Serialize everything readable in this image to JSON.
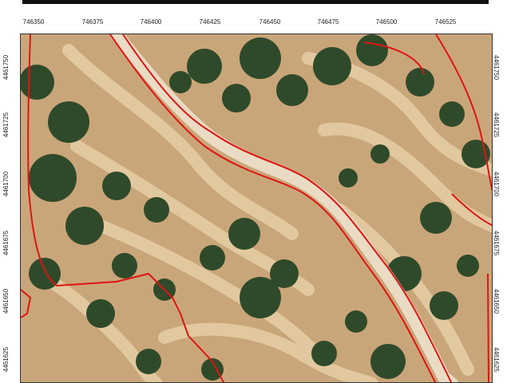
{
  "map": {
    "x_coordinates": [
      "746350",
      "746375",
      "746400",
      "746425",
      "746450",
      "746475",
      "746500",
      "746525"
    ],
    "y_coordinates_left": [
      "4461750",
      "4461725",
      "4461700",
      "4461675",
      "4461650",
      "4461625"
    ],
    "y_coordinates_right": [
      "4461750",
      "4461725",
      "4461700",
      "4461675",
      "4461650",
      "4461625"
    ],
    "colors": {
      "terrain": "#c9a679",
      "terrace_light": "#e6cfa6",
      "vegetation": "#2f4a2a",
      "road": "#eadcc4",
      "boundary": "#e01414"
    },
    "layers": [
      "aerial-orthophoto",
      "terraces",
      "tree-canopy",
      "road",
      "parcel-boundaries"
    ]
  }
}
